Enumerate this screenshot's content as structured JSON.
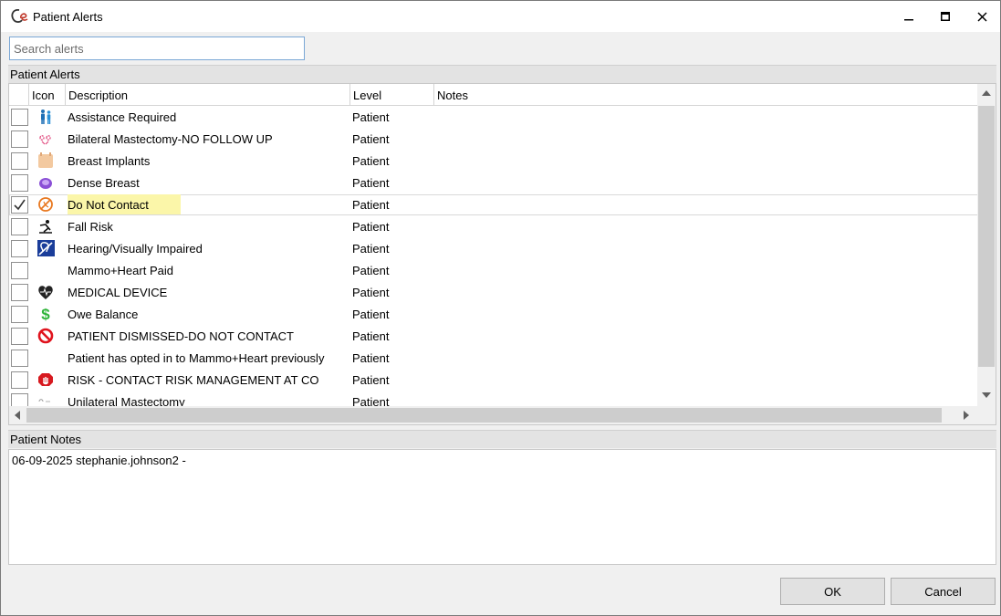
{
  "window": {
    "title": "Patient Alerts"
  },
  "search": {
    "placeholder": "Search alerts",
    "value": ""
  },
  "alerts_section": {
    "title": "Patient Alerts",
    "columns": {
      "icon": "Icon",
      "description": "Description",
      "level": "Level",
      "notes": "Notes"
    },
    "rows": [
      {
        "icon": "assistance-people-icon",
        "description": "Assistance Required",
        "level": "Patient",
        "checked": false
      },
      {
        "icon": "bilateral-mastectomy-icon",
        "description": "Bilateral Mastectomy-NO FOLLOW UP",
        "level": "Patient",
        "checked": false
      },
      {
        "icon": "breast-implants-icon",
        "description": "Breast Implants",
        "level": "Patient",
        "checked": false
      },
      {
        "icon": "dense-breast-icon",
        "description": "Dense Breast",
        "level": "Patient",
        "checked": false
      },
      {
        "icon": "do-not-contact-icon",
        "description": "Do Not Contact",
        "level": "Patient",
        "checked": true
      },
      {
        "icon": "fall-risk-icon",
        "description": "Fall Risk",
        "level": "Patient",
        "checked": false
      },
      {
        "icon": "hearing-visually-impaired-icon",
        "description": "Hearing/Visually Impaired",
        "level": "Patient",
        "checked": false
      },
      {
        "icon": "",
        "description": "Mammo+Heart Paid",
        "level": "Patient",
        "checked": false
      },
      {
        "icon": "heart-device-icon",
        "description": "MEDICAL DEVICE",
        "level": "Patient",
        "checked": false
      },
      {
        "icon": "dollar-icon",
        "description": "Owe Balance",
        "level": "Patient",
        "checked": false
      },
      {
        "icon": "prohibited-icon",
        "description": "PATIENT DISMISSED-DO NOT CONTACT",
        "level": "Patient",
        "checked": false
      },
      {
        "icon": "",
        "description": "Patient has opted in to Mammo+Heart previously",
        "level": "Patient",
        "checked": false
      },
      {
        "icon": "stop-hand-icon",
        "description": "RISK - CONTACT RISK MANAGEMENT AT CO",
        "level": "Patient",
        "checked": false
      },
      {
        "icon": "unilateral-mastectomy-icon",
        "description": "Unilateral Mastectomy",
        "level": "Patient",
        "checked": false
      }
    ]
  },
  "notes_section": {
    "title": "Patient Notes",
    "text": "06-09-2025 stephanie.johnson2 -"
  },
  "buttons": {
    "ok": "OK",
    "cancel": "Cancel"
  },
  "colors": {
    "highlight": "#fbf6a9",
    "search_border": "#7aa7d6",
    "check": "#333333"
  }
}
